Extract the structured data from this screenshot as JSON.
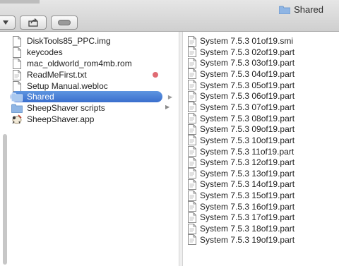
{
  "window": {
    "title": "Shared"
  },
  "toolbar": {
    "view_dropdown_icon": "chevron-down-icon",
    "share_icon": "share-icon",
    "toggle_icon": "pill-icon"
  },
  "column1": {
    "items": [
      {
        "label": "DiskTools85_PPC.img",
        "icon": "document-icon"
      },
      {
        "label": "keycodes",
        "icon": "document-icon"
      },
      {
        "label": "mac_oldworld_rom4mb.rom",
        "icon": "document-icon"
      },
      {
        "label": "ReadMeFirst.txt",
        "icon": "document-icon",
        "tag_color": "#e06b73"
      },
      {
        "label": "Setup Manual.webloc",
        "icon": "document-icon"
      },
      {
        "label": "Shared",
        "icon": "folder-icon",
        "selected": true
      },
      {
        "label": "SheepShaver scripts",
        "icon": "folder-icon"
      },
      {
        "label": "SheepShaver.app",
        "icon": "sheep-app-icon"
      }
    ]
  },
  "column2": {
    "items": [
      "System 7.5.3 01of19.smi",
      "System 7.5.3 02of19.part",
      "System 7.5.3 03of19.part",
      "System 7.5.3 04of19.part",
      "System 7.5.3 05of19.part",
      "System 7.5.3 06of19.part",
      "System 7.5.3 07of19.part",
      "System 7.5.3 08of19.part",
      "System 7.5.3 09of19.part",
      "System 7.5.3 10of19.part",
      "System 7.5.3 11of19.part",
      "System 7.5.3 12of19.part",
      "System 7.5.3 13of19.part",
      "System 7.5.3 14of19.part",
      "System 7.5.3 15of19.part",
      "System 7.5.3 16of19.part",
      "System 7.5.3 17of19.part",
      "System 7.5.3 18of19.part",
      "System 7.5.3 19of19.part"
    ]
  },
  "colors": {
    "selection": "#3a6fcd",
    "tag_red": "#e06b73"
  }
}
